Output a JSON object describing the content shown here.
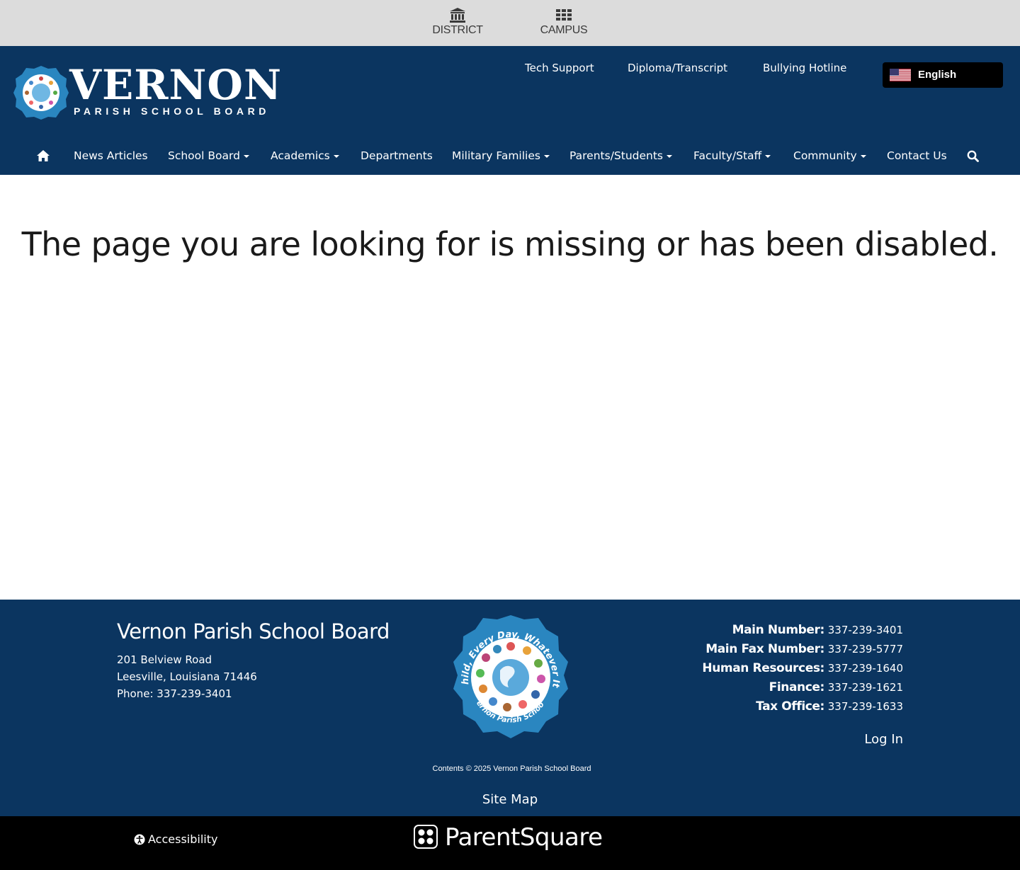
{
  "topbar": {
    "district_label": "DISTRICT",
    "campus_label": "CAMPUS"
  },
  "header": {
    "logo_title": "VERNON",
    "logo_subtitle": "PARISH SCHOOL BOARD",
    "utility_links": [
      "Tech Support",
      "Diploma/Transcript",
      "Bullying Hotline"
    ],
    "language": "English"
  },
  "nav": {
    "items": [
      {
        "label": "News Articles",
        "dropdown": false
      },
      {
        "label": "School Board",
        "dropdown": true
      },
      {
        "label": "Academics",
        "dropdown": true
      },
      {
        "label": "Departments",
        "dropdown": false
      },
      {
        "label": "Military Families",
        "dropdown": true
      },
      {
        "label": "Parents/Students",
        "dropdown": true
      },
      {
        "label": "Faculty/Staff",
        "dropdown": true
      },
      {
        "label": "Community",
        "dropdown": true
      },
      {
        "label": "Contact Us",
        "dropdown": false
      }
    ]
  },
  "main": {
    "message": "The page you are looking for is missing or has been disabled."
  },
  "footer": {
    "org_name": "Vernon Parish School Board",
    "address_line1": "201 Belview Road",
    "address_line2": "Leesville, Louisiana 71446",
    "phone_line": "Phone: 337-239-3401",
    "contacts": [
      {
        "label": "Main Number:",
        "value": "337-239-3401"
      },
      {
        "label": "Main Fax Number:",
        "value": "337-239-5777"
      },
      {
        "label": "Human Resources:",
        "value": "337-239-1640"
      },
      {
        "label": "Finance:",
        "value": "337-239-1621"
      },
      {
        "label": "Tax Office:",
        "value": "337-239-1633"
      }
    ],
    "login": "Log In",
    "copyright": "Contents © 2025 Vernon Parish School Board",
    "sitemap": "Site Map",
    "seal_text_top": "Every Child, Every Day, Whatever It Takes!",
    "seal_text_bottom": "Vernon Parish Schools"
  },
  "bottombar": {
    "accessibility": "Accessibility",
    "parentsquare": "ParentSquare"
  },
  "colors": {
    "header_bg": "#0b3560",
    "topbar_bg": "#dcdcdc",
    "bottombar_bg": "#000000",
    "seal_blue": "#2a86c0"
  }
}
